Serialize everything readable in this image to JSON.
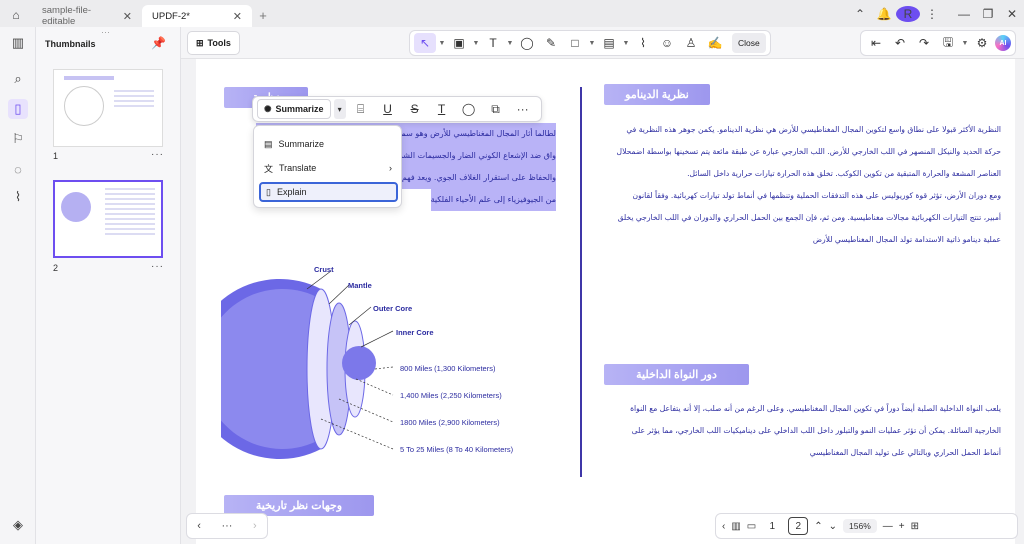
{
  "tabs": [
    {
      "label": "sample-file-editable"
    },
    {
      "label": "UPDF-2*"
    }
  ],
  "window": {
    "avatar_letter": "R"
  },
  "thumbnails": {
    "title": "Thumbnails",
    "pages": [
      {
        "num": "1"
      },
      {
        "num": "2"
      }
    ]
  },
  "toolbar": {
    "tools_label": "Tools",
    "close_label": "Close"
  },
  "popup": {
    "summarize_label": "Summarize",
    "menu": {
      "summarize": "Summarize",
      "translate": "Translate",
      "explain": "Explain"
    }
  },
  "page": {
    "left_heading": "نظرية",
    "left_lines": [
      "لطالما أثار المجال المغناطيسي للأرض وهو سمة",
      "واق ضد الإشعاع الكوني الضار والجسيمات الشمسية",
      "والحفاظ على استقرار الغلاف الجوي. ويعد فهم ك",
      "من الجيوفيزياء إلى علم الأحياء الفلكية"
    ],
    "right_heading1": "نظرية الدينامو",
    "right_para1": [
      "النظرية الأكثر قبولا على نطاق واسع لتكوين المجال المغناطيسي للأرض هي نظرية الدينامو. يكمن جوهر هذه النظرية في",
      "حركة الحديد والنيكل المنصهر في اللب الخارجي للأرض. اللب الخارجي عبارة عن طبقة مائعة يتم تسخينها بواسطة اضمحلال",
      "العناصر المشعة والحرارة المتبقية من تكوين الكوكب. تخلق هذه الحرارة تيارات حرارية داخل السائل.",
      "ومع دوران الأرض، تؤثر قوة كوريوليس على هذه التدفقات الحملية وتنظمها في أنماط تولد تيارات كهربائية. وفقاً لقانون",
      "أمبير، تنتج التيارات الكهربائية مجالات مغناطيسية. ومن ثم، فإن الجمع بين الحمل الحراري والدوران في اللب الخارجي يخلق",
      "عملية دينامو ذاتية الاستدامة تولد المجال المغناطيسي للأرض"
    ],
    "right_heading2": "دور النواة الداخلية",
    "right_para2": [
      "يلعب النواة الداخلية الصلبة أيضاً دوراً في تكوين المجال المغناطيسي. وعلى الرغم من أنه صلب، إلا أنه يتفاعل مع النواة",
      "الخارجية السائلة. يمكن أن تؤثر عمليات النمو والتبلور داخل اللب الداخلي على ديناميكيات اللب الخارجي، مما يؤثر على",
      "أنماط الحمل الحراري وبالتالي على توليد المجال المغناطيسي"
    ],
    "bottom_heading": "وجهات نظر تاريخية",
    "earth_labels": {
      "crust": "Crust",
      "mantle": "Mantle",
      "outer": "Outer Core",
      "inner": "Inner Core"
    },
    "distances": [
      "800 Miles (1,300 Kilometers)",
      "1,400 Miles (2,250 Kilometers)",
      "1800 Miles (2,900 Kilometers)",
      "5 To 25 Miles (8 To 40 Kilometers)"
    ]
  },
  "pager": {
    "page1": "1",
    "page2": "2",
    "zoom": "156%"
  }
}
